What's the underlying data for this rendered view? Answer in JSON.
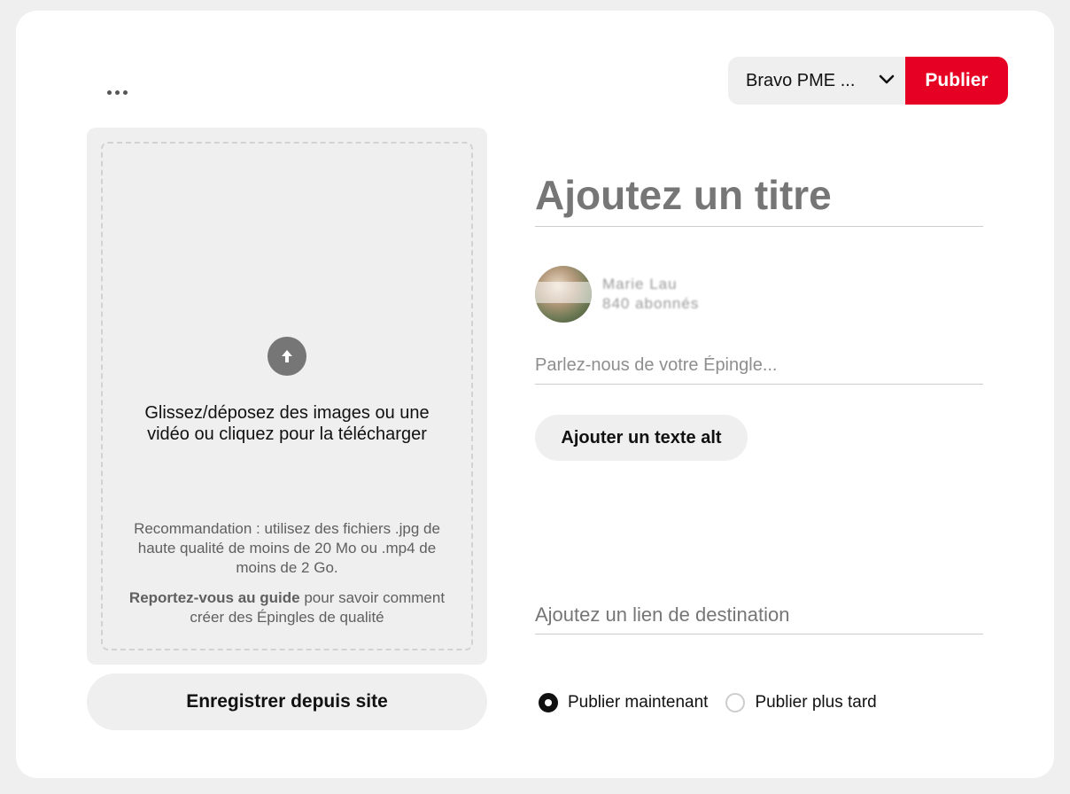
{
  "header": {
    "more_icon": "more-horizontal-icon",
    "board_select": "Bravo PME ...",
    "publish_label": "Publier",
    "accent_color": "#e60023"
  },
  "upload": {
    "icon": "arrow-up-icon",
    "instructions": "Glissez/déposez des images ou une vidéo ou cliquez pour la télécharger",
    "recommendation": "Recommandation : utilisez des fichiers .jpg de haute qualité de moins de 20 Mo ou .mp4 de moins de 2 Go.",
    "guide_link": "Reportez-vous au guide",
    "guide_rest": " pour savoir comment créer des Épingles de qualité"
  },
  "save_from_site_label": "Enregistrer depuis site",
  "form": {
    "title_placeholder": "Ajoutez un titre",
    "user_name": "Marie Lau",
    "user_followers": "840 abonnés",
    "description_placeholder": "Parlez-nous de votre Épingle...",
    "alt_text_label": "Ajouter un texte alt",
    "link_placeholder": "Ajoutez un lien de destination"
  },
  "publish_options": [
    {
      "label": "Publier maintenant",
      "selected": true
    },
    {
      "label": "Publier plus tard",
      "selected": false
    }
  ]
}
